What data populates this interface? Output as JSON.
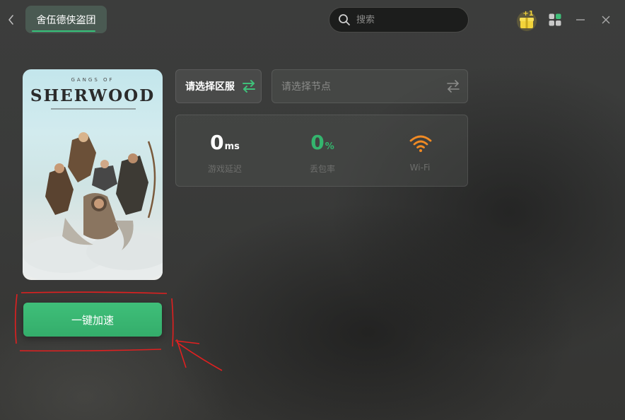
{
  "header": {
    "active_tab": "舍伍德侠盗团",
    "search_placeholder": "搜索",
    "gift_badge": "+1"
  },
  "game": {
    "cover_subtitle": "GANGS OF",
    "cover_title": "SHERWOOD",
    "accelerate_label": "一键加速"
  },
  "server": {
    "region_label": "请选择区服",
    "node_placeholder": "请选择节点"
  },
  "stats": {
    "latency_value": "0",
    "latency_unit": "ms",
    "latency_label": "游戏延迟",
    "loss_value": "0",
    "loss_unit": "%",
    "loss_label": "丢包率",
    "network_label": "Wi-Fi"
  },
  "colors": {
    "accent_green": "#34ad6b",
    "wifi_orange": "#f08a24",
    "gift_yellow": "#f2d43a",
    "annotation_red": "#e02020"
  }
}
